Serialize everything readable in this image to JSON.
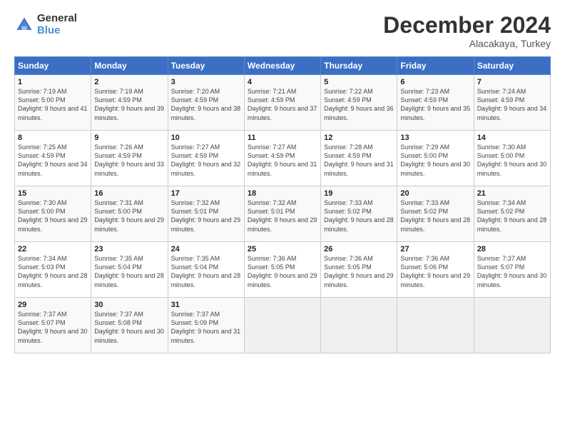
{
  "header": {
    "logo_general": "General",
    "logo_blue": "Blue",
    "month_title": "December 2024",
    "location": "Alacakaya, Turkey"
  },
  "weekdays": [
    "Sunday",
    "Monday",
    "Tuesday",
    "Wednesday",
    "Thursday",
    "Friday",
    "Saturday"
  ],
  "rows": [
    [
      {
        "day": "1",
        "sunrise": "Sunrise: 7:19 AM",
        "sunset": "Sunset: 5:00 PM",
        "daylight": "Daylight: 9 hours and 41 minutes."
      },
      {
        "day": "2",
        "sunrise": "Sunrise: 7:19 AM",
        "sunset": "Sunset: 4:59 PM",
        "daylight": "Daylight: 9 hours and 39 minutes."
      },
      {
        "day": "3",
        "sunrise": "Sunrise: 7:20 AM",
        "sunset": "Sunset: 4:59 PM",
        "daylight": "Daylight: 9 hours and 38 minutes."
      },
      {
        "day": "4",
        "sunrise": "Sunrise: 7:21 AM",
        "sunset": "Sunset: 4:59 PM",
        "daylight": "Daylight: 9 hours and 37 minutes."
      },
      {
        "day": "5",
        "sunrise": "Sunrise: 7:22 AM",
        "sunset": "Sunset: 4:59 PM",
        "daylight": "Daylight: 9 hours and 36 minutes."
      },
      {
        "day": "6",
        "sunrise": "Sunrise: 7:23 AM",
        "sunset": "Sunset: 4:59 PM",
        "daylight": "Daylight: 9 hours and 35 minutes."
      },
      {
        "day": "7",
        "sunrise": "Sunrise: 7:24 AM",
        "sunset": "Sunset: 4:59 PM",
        "daylight": "Daylight: 9 hours and 34 minutes."
      }
    ],
    [
      {
        "day": "8",
        "sunrise": "Sunrise: 7:25 AM",
        "sunset": "Sunset: 4:59 PM",
        "daylight": "Daylight: 9 hours and 34 minutes."
      },
      {
        "day": "9",
        "sunrise": "Sunrise: 7:26 AM",
        "sunset": "Sunset: 4:59 PM",
        "daylight": "Daylight: 9 hours and 33 minutes."
      },
      {
        "day": "10",
        "sunrise": "Sunrise: 7:27 AM",
        "sunset": "Sunset: 4:59 PM",
        "daylight": "Daylight: 9 hours and 32 minutes."
      },
      {
        "day": "11",
        "sunrise": "Sunrise: 7:27 AM",
        "sunset": "Sunset: 4:59 PM",
        "daylight": "Daylight: 9 hours and 31 minutes."
      },
      {
        "day": "12",
        "sunrise": "Sunrise: 7:28 AM",
        "sunset": "Sunset: 4:59 PM",
        "daylight": "Daylight: 9 hours and 31 minutes."
      },
      {
        "day": "13",
        "sunrise": "Sunrise: 7:29 AM",
        "sunset": "Sunset: 5:00 PM",
        "daylight": "Daylight: 9 hours and 30 minutes."
      },
      {
        "day": "14",
        "sunrise": "Sunrise: 7:30 AM",
        "sunset": "Sunset: 5:00 PM",
        "daylight": "Daylight: 9 hours and 30 minutes."
      }
    ],
    [
      {
        "day": "15",
        "sunrise": "Sunrise: 7:30 AM",
        "sunset": "Sunset: 5:00 PM",
        "daylight": "Daylight: 9 hours and 29 minutes."
      },
      {
        "day": "16",
        "sunrise": "Sunrise: 7:31 AM",
        "sunset": "Sunset: 5:00 PM",
        "daylight": "Daylight: 9 hours and 29 minutes."
      },
      {
        "day": "17",
        "sunrise": "Sunrise: 7:32 AM",
        "sunset": "Sunset: 5:01 PM",
        "daylight": "Daylight: 9 hours and 29 minutes."
      },
      {
        "day": "18",
        "sunrise": "Sunrise: 7:32 AM",
        "sunset": "Sunset: 5:01 PM",
        "daylight": "Daylight: 9 hours and 29 minutes."
      },
      {
        "day": "19",
        "sunrise": "Sunrise: 7:33 AM",
        "sunset": "Sunset: 5:02 PM",
        "daylight": "Daylight: 9 hours and 28 minutes."
      },
      {
        "day": "20",
        "sunrise": "Sunrise: 7:33 AM",
        "sunset": "Sunset: 5:02 PM",
        "daylight": "Daylight: 9 hours and 28 minutes."
      },
      {
        "day": "21",
        "sunrise": "Sunrise: 7:34 AM",
        "sunset": "Sunset: 5:02 PM",
        "daylight": "Daylight: 9 hours and 28 minutes."
      }
    ],
    [
      {
        "day": "22",
        "sunrise": "Sunrise: 7:34 AM",
        "sunset": "Sunset: 5:03 PM",
        "daylight": "Daylight: 9 hours and 28 minutes."
      },
      {
        "day": "23",
        "sunrise": "Sunrise: 7:35 AM",
        "sunset": "Sunset: 5:04 PM",
        "daylight": "Daylight: 9 hours and 28 minutes."
      },
      {
        "day": "24",
        "sunrise": "Sunrise: 7:35 AM",
        "sunset": "Sunset: 5:04 PM",
        "daylight": "Daylight: 9 hours and 28 minutes."
      },
      {
        "day": "25",
        "sunrise": "Sunrise: 7:36 AM",
        "sunset": "Sunset: 5:05 PM",
        "daylight": "Daylight: 9 hours and 29 minutes."
      },
      {
        "day": "26",
        "sunrise": "Sunrise: 7:36 AM",
        "sunset": "Sunset: 5:05 PM",
        "daylight": "Daylight: 9 hours and 29 minutes."
      },
      {
        "day": "27",
        "sunrise": "Sunrise: 7:36 AM",
        "sunset": "Sunset: 5:06 PM",
        "daylight": "Daylight: 9 hours and 29 minutes."
      },
      {
        "day": "28",
        "sunrise": "Sunrise: 7:37 AM",
        "sunset": "Sunset: 5:07 PM",
        "daylight": "Daylight: 9 hours and 30 minutes."
      }
    ],
    [
      {
        "day": "29",
        "sunrise": "Sunrise: 7:37 AM",
        "sunset": "Sunset: 5:07 PM",
        "daylight": "Daylight: 9 hours and 30 minutes."
      },
      {
        "day": "30",
        "sunrise": "Sunrise: 7:37 AM",
        "sunset": "Sunset: 5:08 PM",
        "daylight": "Daylight: 9 hours and 30 minutes."
      },
      {
        "day": "31",
        "sunrise": "Sunrise: 7:37 AM",
        "sunset": "Sunset: 5:09 PM",
        "daylight": "Daylight: 9 hours and 31 minutes."
      },
      null,
      null,
      null,
      null
    ]
  ]
}
